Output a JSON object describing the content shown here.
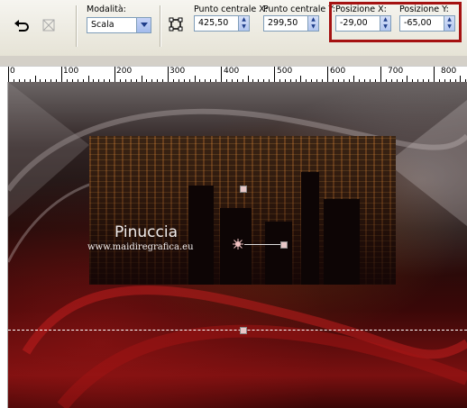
{
  "toolbar": {
    "mode_label": "Modalità:",
    "mode_value": "Scala",
    "center_x_label": "Punto centrale X:",
    "center_x_value": "425,50",
    "center_y_label": "Punto centrale Y:",
    "center_y_value": "299,50",
    "pos_x_label": "Posizione X:",
    "pos_x_value": "-29,00",
    "pos_y_label": "Posizione Y:",
    "pos_y_value": "-65,00"
  },
  "ruler": {
    "labels": [
      "0",
      "100",
      "200",
      "300",
      "400",
      "500",
      "600",
      "700",
      "800"
    ]
  },
  "canvas": {
    "watermark_title": "Pinuccia",
    "watermark_url": "www.maidiregrafica.eu"
  },
  "colors": {
    "highlight_box": "#a51212"
  }
}
